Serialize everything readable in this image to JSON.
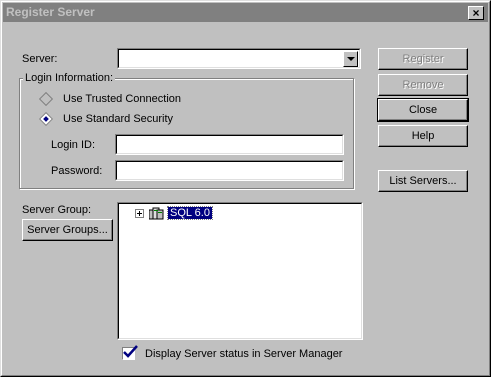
{
  "window": {
    "title": "Register Server",
    "close_glyph": "×"
  },
  "server": {
    "label": "Server:",
    "value": ""
  },
  "login_group": {
    "title": "Login Information:",
    "trusted_label": "Use Trusted Connection",
    "standard_label": "Use Standard Security",
    "selected": "standard"
  },
  "login_id": {
    "label": "Login ID:",
    "value": ""
  },
  "password": {
    "label": "Password:",
    "value": ""
  },
  "server_group": {
    "label": "Server Group:",
    "button_label": "Server Groups..."
  },
  "tree": {
    "items": [
      {
        "label": "SQL 6.0",
        "icon": "server-group-icon",
        "selected": true
      }
    ]
  },
  "display_status": {
    "label": "Display Server status in Server Manager",
    "checked": true
  },
  "buttons": {
    "register": "Register",
    "remove": "Remove",
    "close": "Close",
    "help": "Help",
    "list_servers": "List Servers..."
  },
  "colors": {
    "titlebar_inactive": "#808080",
    "selection": "#000080",
    "face": "#c0c0c0"
  }
}
